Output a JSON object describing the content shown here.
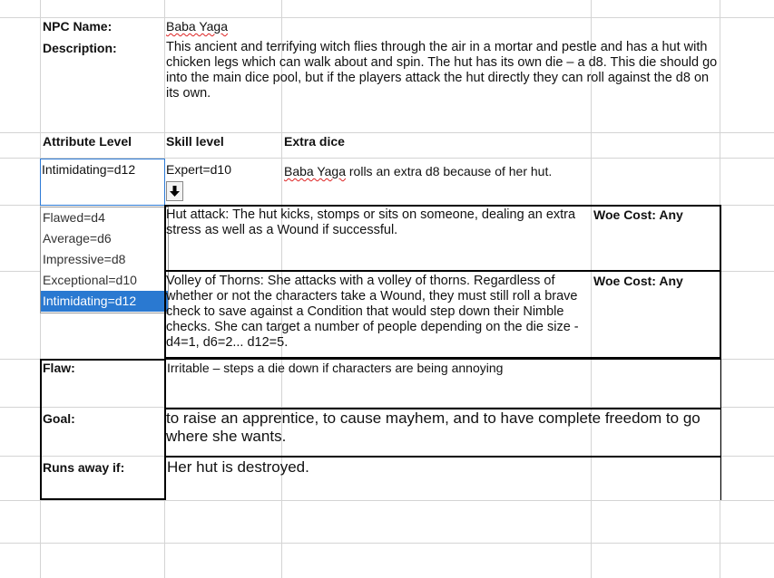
{
  "npc": {
    "name_label": "NPC Name:",
    "name_value": "Baba Yaga",
    "desc_label": "Description:",
    "desc_value": "This ancient and terrifying witch flies through the air in a mortar and pestle and has a hut with chicken legs which can walk about and spin. The hut has its own die – a d8. This die should go into the main dice pool, but if the players attack the hut directly they can roll against the d8 on its own."
  },
  "headers": {
    "attribute": "Attribute Level",
    "skill": "Skill level",
    "extra": "Extra dice"
  },
  "values": {
    "attribute": "Intimidating=d12",
    "skill": "Expert=d10",
    "extra_name": "Baba Yaga",
    "extra_rest": " rolls an extra d8 because of her hut."
  },
  "dropdown": {
    "options": [
      "Flawed=d4",
      "Average=d6",
      "Impressive=d8",
      "Exceptional=d10",
      "Intimidating=d12"
    ],
    "selected": "Intimidating=d12"
  },
  "attacks": [
    {
      "text": "Hut attack: The hut kicks, stomps or sits on someone, dealing an extra stress as well as a Wound if successful.",
      "woe": "Woe Cost: Any"
    },
    {
      "text": "Volley of Thorns: She attacks with a volley of thorns. Regardless of whether or not the characters take a Wound, they must still roll a brave check to save against a Condition that would step down their Nimble checks. She can target a number of people depending on the die size - d4=1, d6=2... d12=5.",
      "woe": "Woe Cost: Any"
    }
  ],
  "traits": {
    "flaw_label": "Flaw:",
    "flaw_value": "Irritable – steps a die down if characters are being annoying",
    "goal_label": "Goal:",
    "goal_value": "to raise an apprentice, to cause mayhem, and to have complete freedom to go where she wants.",
    "runs_label": "Runs away if:",
    "runs_value": "Her hut is destroyed."
  }
}
